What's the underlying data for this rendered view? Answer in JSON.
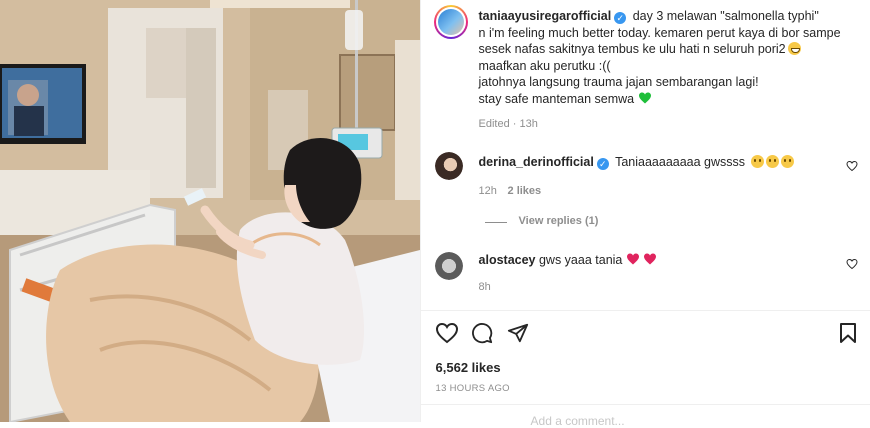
{
  "post": {
    "author": "taniaayusiregarofficial",
    "caption_lines": [
      "day 3 melawan \"salmonella typhi\"",
      "n i'm feeling much better today. kemaren perut kaya di bor sampe",
      "sesek nafas sakitnya tembus ke ulu hati n seluruh pori2",
      "maafkan aku perutku :((",
      "jatohnya langsung trauma jajan sembarangan lagi!",
      "stay safe manteman semwa"
    ],
    "edited_meta": "Edited · 13h"
  },
  "comments": [
    {
      "username": "derina_derinofficial",
      "text": "Taniaaaaaaaaa gwssss",
      "time": "12h",
      "likes": "2 likes",
      "view_replies": "View replies (1)"
    },
    {
      "username": "alostacey",
      "text": "gws yaaa tania",
      "time": "8h"
    }
  ],
  "footer": {
    "likes": "6,562 likes",
    "time_ago": "13 HOURS AGO",
    "add_comment_placeholder": "Add a comment..."
  },
  "icons": {
    "like": "heart-icon",
    "comment": "comment-icon",
    "share": "paper-plane-icon",
    "save": "bookmark-icon",
    "verified": "verified-badge-icon",
    "comment_like": "heart-outline-icon"
  },
  "colors": {
    "verified": "#3897f0",
    "heart_red": "#e0245e",
    "green_heart": "#1fbf3a",
    "muted": "#8e8e8e"
  }
}
